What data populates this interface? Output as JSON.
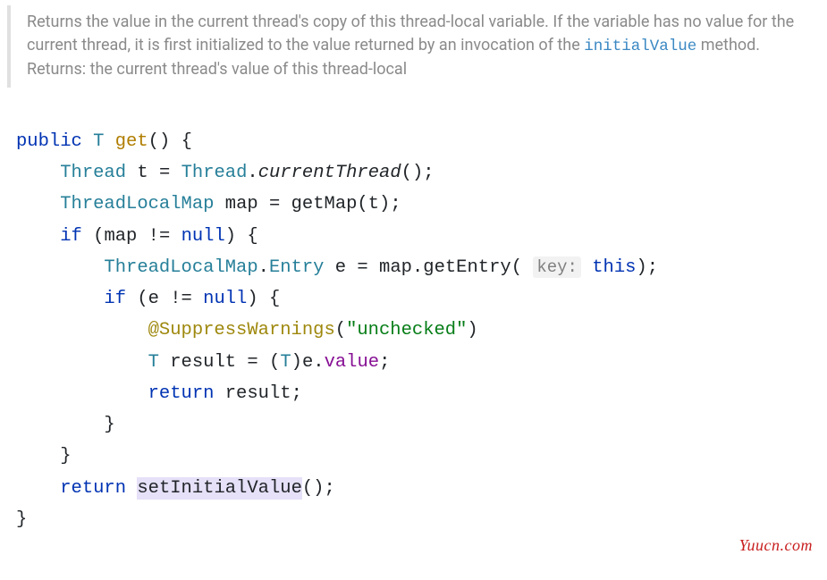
{
  "doc": {
    "summary_part1": "Returns the value in the current thread's copy of this thread-local variable. If the variable has no value for the current thread, it is first initialized to the value returned by an invocation of the ",
    "summary_link": "initialValue",
    "summary_part2": " method.",
    "returns_line": "Returns: the current thread's value of this thread-local"
  },
  "code": {
    "kw_public": "public",
    "type_T": "T",
    "method_get": "get",
    "parens_empty": "()",
    "brace_open": "{",
    "brace_close": "}",
    "type_Thread": "Thread",
    "var_t": "t",
    "eq": "=",
    "dot": ".",
    "call_currentThread": "currentThread",
    "semi": ";",
    "type_ThreadLocalMap": "ThreadLocalMap",
    "var_map": "map",
    "call_getMap": "getMap",
    "arg_t": "(t)",
    "kw_if": "if",
    "cond_mapnn_open": "(map != ",
    "kw_null": "null",
    "cond_close": ")",
    "type_Entry": "Entry",
    "var_e": "e",
    "call_getEntry": "getEntry",
    "hint_key": "key:",
    "kw_this": "this",
    "paren_open": "(",
    "paren_close": ")",
    "cond_enn_open": "(e != ",
    "annot_sw": "@SuppressWarnings",
    "str_unchecked": "\"unchecked\"",
    "var_result": "result",
    "cast_open": "(",
    "cast_close": ")",
    "field_value": "value",
    "kw_return": "return",
    "call_setInitialValue": "setInitialValue"
  },
  "watermark": "Yuucn.com"
}
